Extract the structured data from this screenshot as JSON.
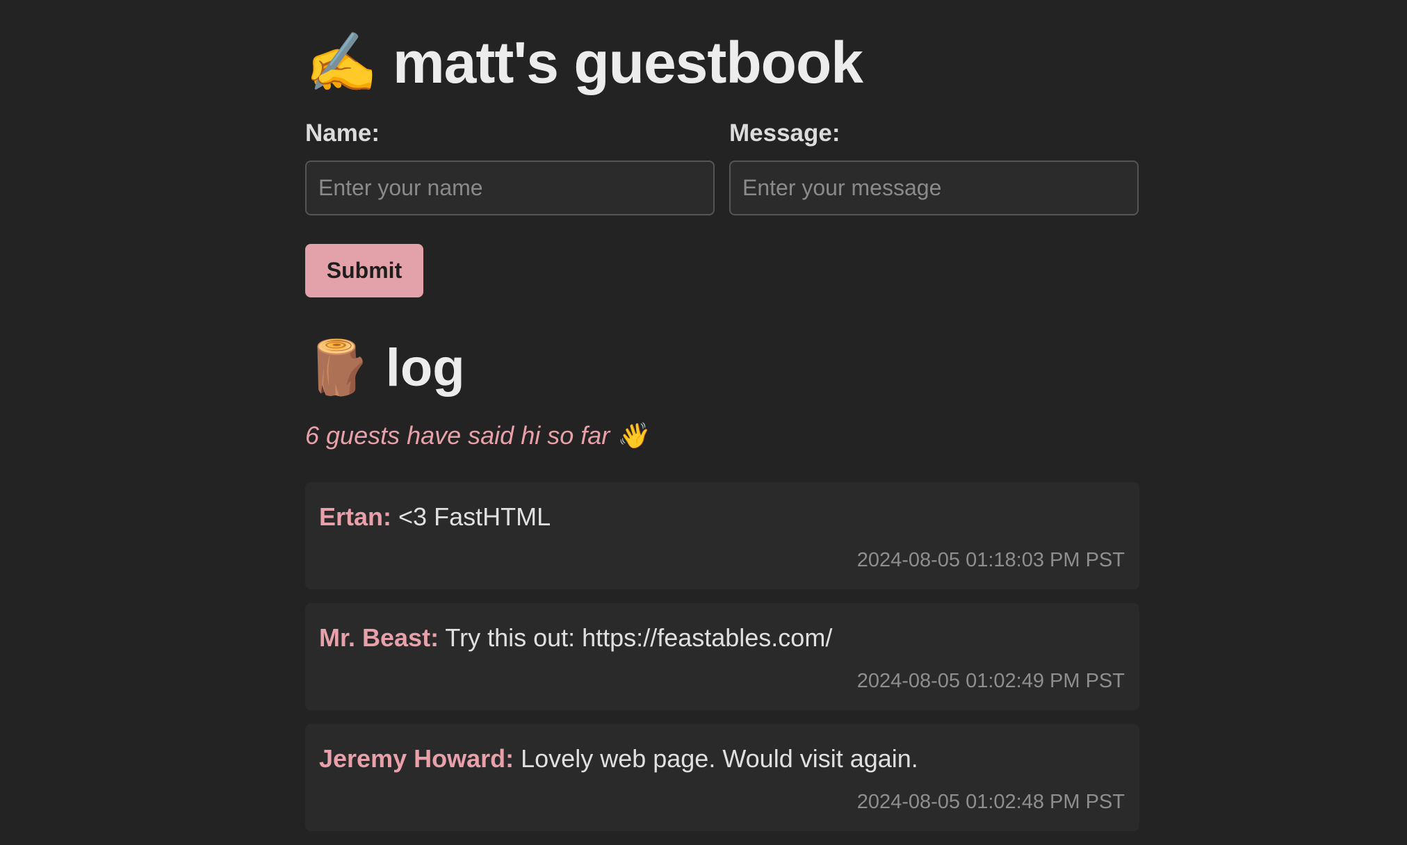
{
  "header": {
    "title_emoji": "✍️",
    "title": "matt's guestbook"
  },
  "form": {
    "name_label": "Name:",
    "name_placeholder": "Enter your name",
    "message_label": "Message:",
    "message_placeholder": "Enter your message",
    "submit_label": "Submit"
  },
  "log": {
    "title_emoji": "🪵",
    "title": "log",
    "count_text": "6 guests have said hi so far",
    "count_emoji": "👋"
  },
  "entries": [
    {
      "author": "Ertan:",
      "message": "<3 FastHTML",
      "timestamp": "2024-08-05 01:18:03 PM PST"
    },
    {
      "author": "Mr. Beast:",
      "message": "Try this out: https://feastables.com/",
      "timestamp": "2024-08-05 01:02:49 PM PST"
    },
    {
      "author": "Jeremy Howard:",
      "message": "Lovely web page. Would visit again.",
      "timestamp": "2024-08-05 01:02:48 PM PST"
    }
  ],
  "colors": {
    "background": "#232323",
    "accent": "#e3a2aa",
    "card": "#2a2a2a"
  }
}
